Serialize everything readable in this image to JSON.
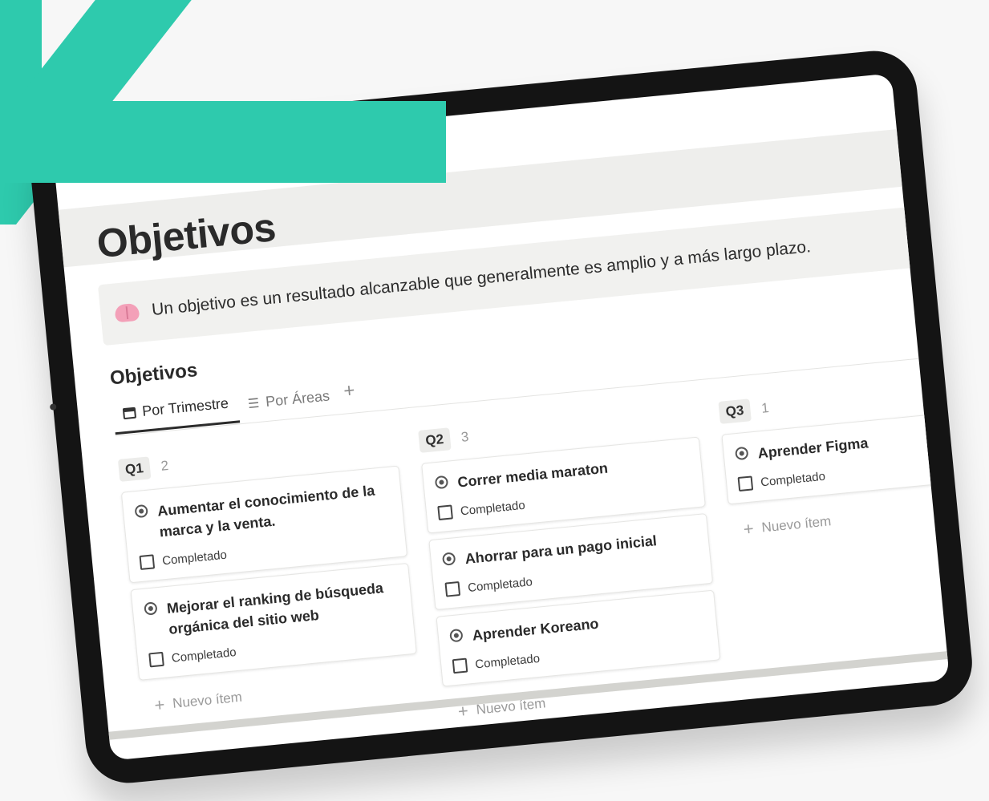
{
  "page": {
    "title": "Objetivos",
    "callout_text": "Un objetivo es un resultado alcanzable que generalmente es amplio y a más largo plazo.",
    "callout_icon": "brain-icon"
  },
  "database": {
    "title": "Objetivos",
    "views": [
      {
        "label": "Por Trimestre",
        "icon": "calendar-icon",
        "active": true
      },
      {
        "label": "Por Áreas",
        "icon": "layers-icon",
        "active": false
      }
    ],
    "add_view_label": "+"
  },
  "board": {
    "columns": [
      {
        "label": "Q1",
        "count": "2",
        "cards": [
          {
            "title": "Aumentar el conocimiento de la marca y la venta.",
            "checkbox_label": "Completado"
          },
          {
            "title": "Mejorar el ranking de búsqueda orgánica del sitio web",
            "checkbox_label": "Completado"
          }
        ],
        "new_item_label": "Nuevo ítem"
      },
      {
        "label": "Q2",
        "count": "3",
        "cards": [
          {
            "title": "Correr media maraton",
            "checkbox_label": "Completado"
          },
          {
            "title": "Ahorrar para un pago inicial",
            "checkbox_label": "Completado"
          },
          {
            "title": "Aprender Koreano",
            "checkbox_label": "Completado"
          }
        ],
        "new_item_label": "Nuevo ítem"
      },
      {
        "label": "Q3",
        "count": "1",
        "cards": [
          {
            "title": "Aprender Figma",
            "checkbox_label": "Completado"
          }
        ],
        "new_item_label": "Nuevo ítem"
      }
    ]
  },
  "colors": {
    "accent": "#2ecaad",
    "device": "#141414"
  }
}
